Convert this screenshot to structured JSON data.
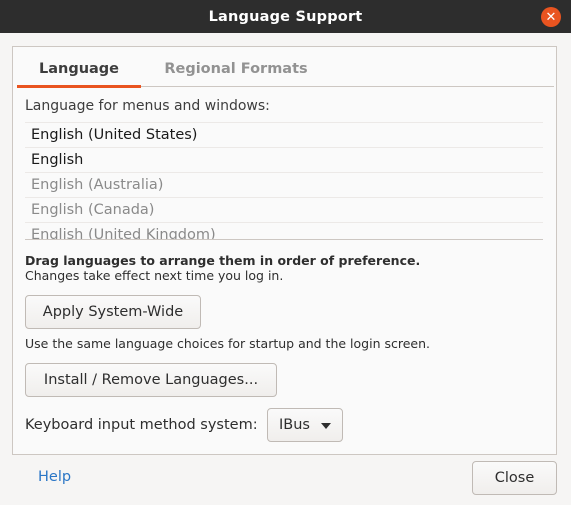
{
  "window": {
    "title": "Language Support"
  },
  "tabs": [
    {
      "label": "Language"
    },
    {
      "label": "Regional Formats"
    }
  ],
  "language": {
    "list_label": "Language for menus and windows:",
    "items": [
      {
        "label": "English (United States)"
      },
      {
        "label": "English"
      },
      {
        "label": "English (Australia)"
      },
      {
        "label": "English (Canada)"
      },
      {
        "label": "English (United Kingdom)"
      }
    ],
    "drag_note_bold": "Drag languages to arrange them in order of preference.",
    "drag_note": "Changes take effect next time you log in.",
    "apply_label": "Apply System-Wide",
    "apply_note": "Use the same language choices for startup and the login screen.",
    "install_label": "Install / Remove Languages...",
    "keyboard_label": "Keyboard input method system:",
    "keyboard_value": "IBus"
  },
  "footer": {
    "help_label": "Help",
    "close_label": "Close"
  },
  "colors": {
    "accent": "#e95420",
    "link": "#2a76c6",
    "titlebar": "#2d2d2d"
  }
}
